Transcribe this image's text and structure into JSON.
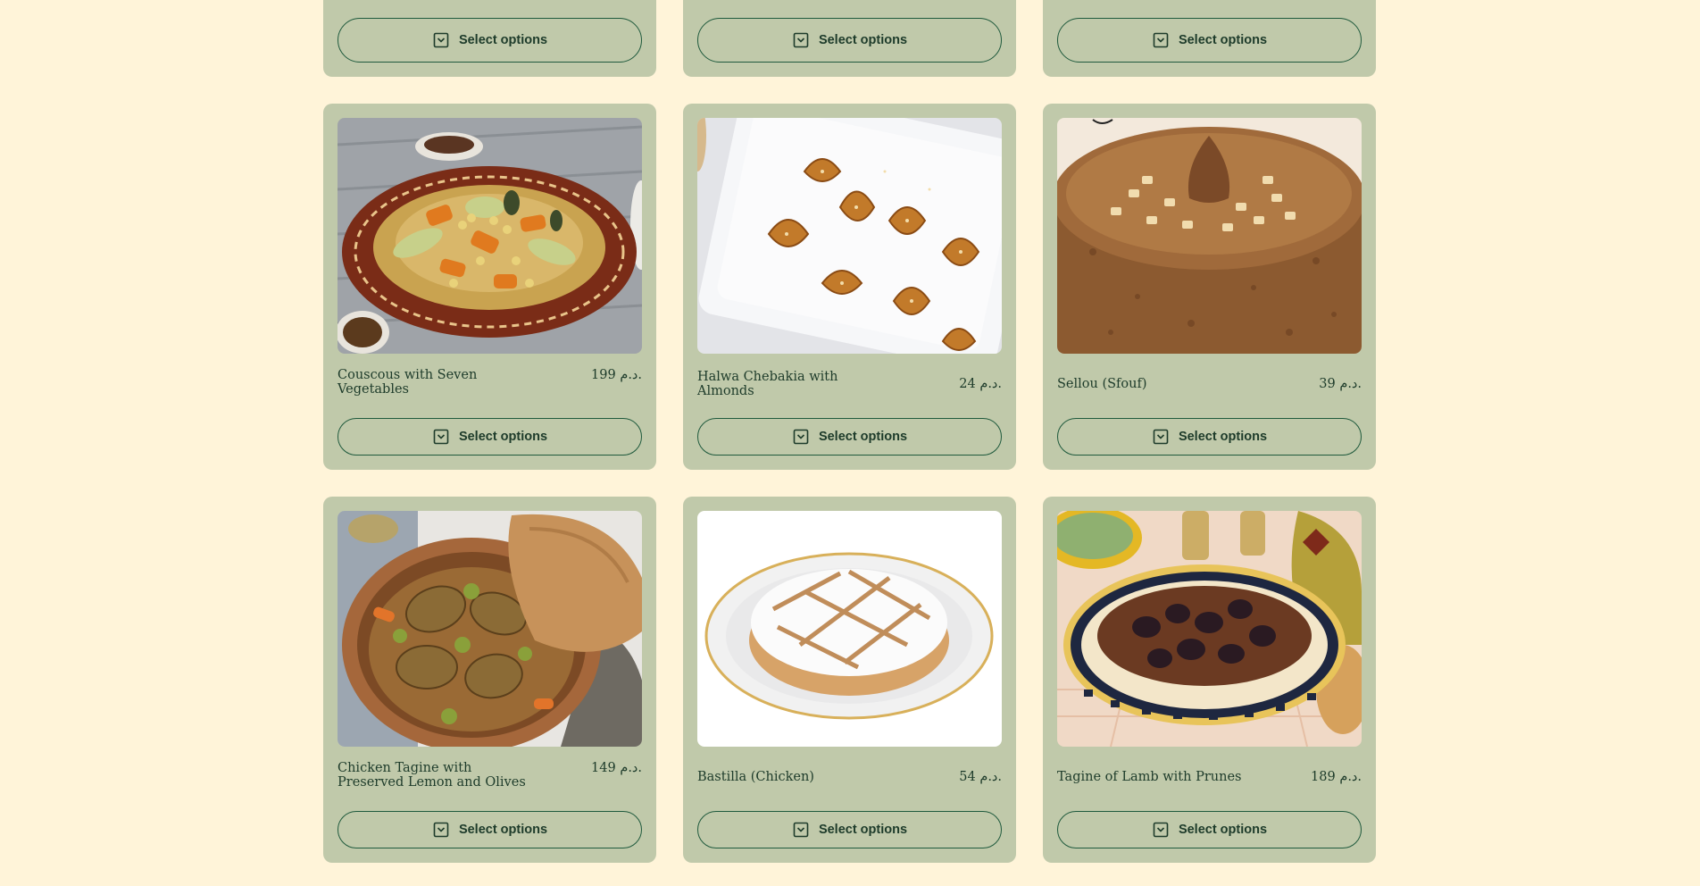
{
  "colors": {
    "page_background": "#fff4d9",
    "card_background": "#c0c9aa",
    "accent": "#1f5a3d",
    "text": "#1d3b2a"
  },
  "button_icon": "select-options-icon",
  "top_row": [
    {
      "button_label": "Select options"
    },
    {
      "button_label": "Select options"
    },
    {
      "button_label": "Select options"
    }
  ],
  "products": [
    {
      "title": "Couscous with Seven Vegetables",
      "price": "199 د.م.",
      "button_label": "Select options",
      "image": "couscous-dish"
    },
    {
      "title": "Halwa Chebakia with Almonds",
      "price": "24 د.م.",
      "button_label": "Select options",
      "image": "chebakia-pastries"
    },
    {
      "title": "Sellou (Sfouf)",
      "price": "39 د.م.",
      "button_label": "Select options",
      "image": "sellou-cake"
    },
    {
      "title": "Chicken Tagine with Preserved Lemon and Olives",
      "price": "149 د.م.",
      "button_label": "Select options",
      "image": "chicken-tagine"
    },
    {
      "title": "Bastilla (Chicken)",
      "price": "54 د.م.",
      "button_label": "Select options",
      "image": "bastilla-pie"
    },
    {
      "title": "Tagine of Lamb with Prunes",
      "price": "189 د.م.",
      "button_label": "Select options",
      "image": "lamb-tagine"
    }
  ]
}
